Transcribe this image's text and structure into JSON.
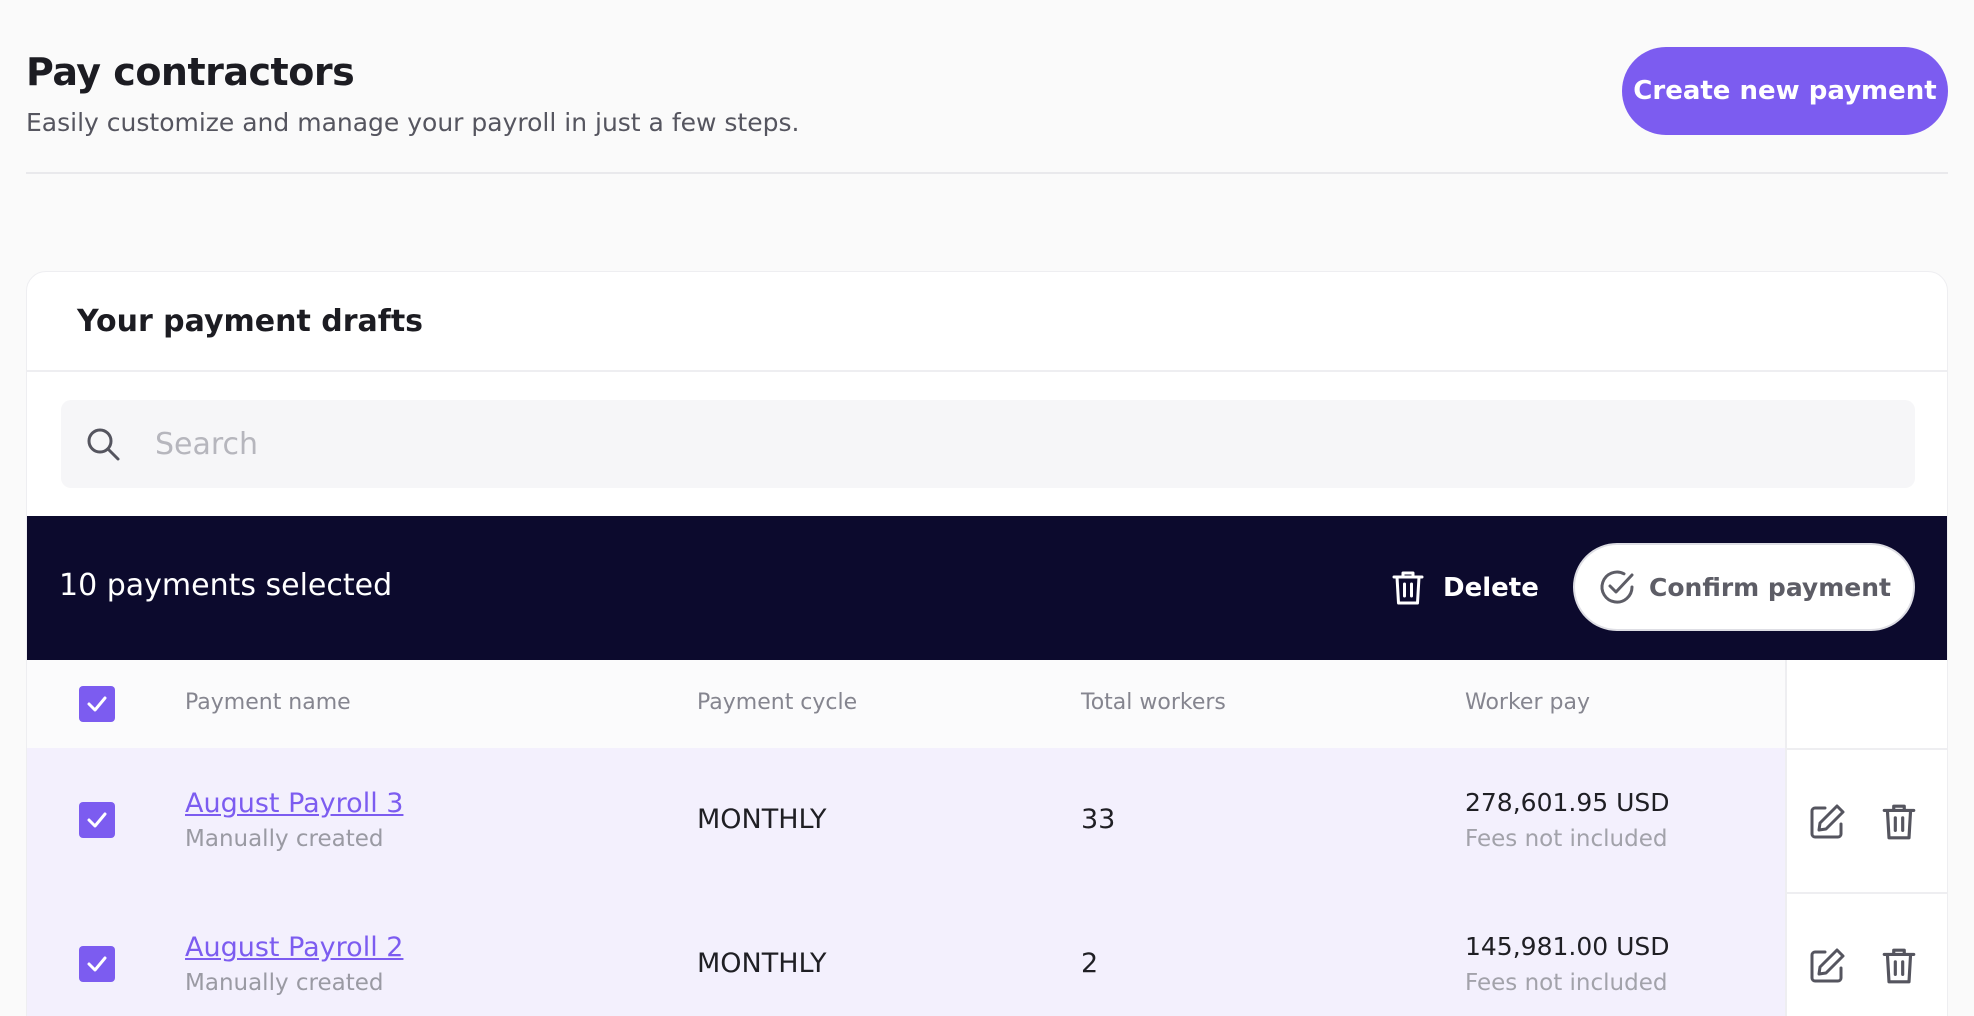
{
  "header": {
    "title": "Pay contractors",
    "subtitle": "Easily customize and manage your payroll in just a few steps.",
    "create_button": "Create new payment"
  },
  "drafts": {
    "title": "Your payment drafts",
    "search": {
      "placeholder": "Search",
      "value": "",
      "icon": "search-icon"
    },
    "selection_bar": {
      "count_text": "10 payments selected",
      "delete_label": "Delete",
      "confirm_label": "Confirm payment"
    },
    "columns": [
      "Payment name",
      "Payment cycle",
      "Total workers",
      "Worker pay"
    ],
    "rows": [
      {
        "name": "August Payroll 3",
        "source": "Manually created",
        "cycle": "MONTHLY",
        "workers": "33",
        "amount": "278,601.95 USD",
        "fees": "Fees not included",
        "checked": true
      },
      {
        "name": "August Payroll 2",
        "source": "Manually created",
        "cycle": "MONTHLY",
        "workers": "2",
        "amount": "145,981.00 USD",
        "fees": "Fees not included",
        "checked": true
      }
    ]
  },
  "colors": {
    "accent": "#7c5cf0",
    "selection_bar": "#0c0a2d",
    "row_selected": "#f3f0fd"
  }
}
